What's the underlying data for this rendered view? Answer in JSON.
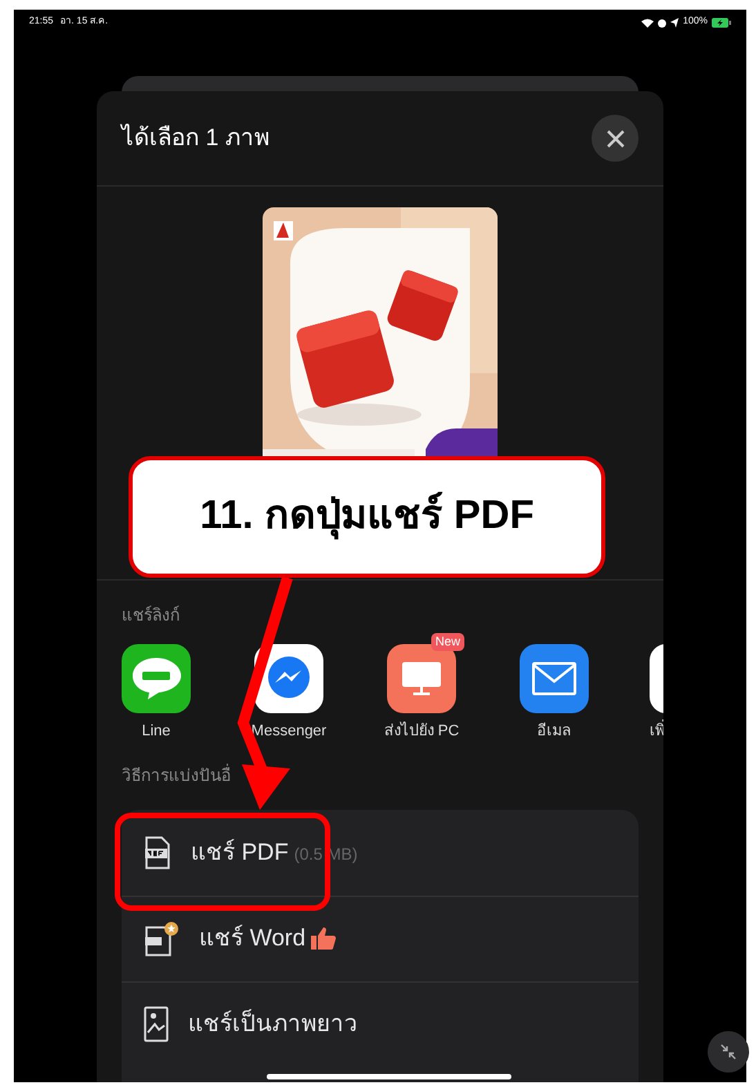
{
  "status_bar": {
    "time": "21:55",
    "date": "อา. 15 ส.ค.",
    "battery": "100%"
  },
  "sheet": {
    "title": "ได้เลือก 1 ภาพ",
    "share_link": {
      "heading": "แชร์ลิงก์",
      "apps": [
        {
          "label": "Line",
          "kind": "line"
        },
        {
          "label": "Messenger",
          "kind": "messenger"
        },
        {
          "label": "ส่งไปยัง PC",
          "kind": "pc",
          "badge": "New"
        },
        {
          "label": "อีเมล",
          "kind": "email"
        },
        {
          "label": "เพิ่",
          "kind": "more"
        }
      ]
    },
    "other": {
      "heading": "วิธีการแบ่งปันอื่",
      "options": [
        {
          "label": "แชร์ PDF",
          "note": "(0.5 MB)",
          "kind": "pdf"
        },
        {
          "label": "แชร์ Word",
          "kind": "word"
        },
        {
          "label": "แชร์เป็นภาพยาว",
          "kind": "long"
        }
      ]
    }
  },
  "annotation": {
    "text": "11. กดปุ่มแชร์ PDF"
  }
}
